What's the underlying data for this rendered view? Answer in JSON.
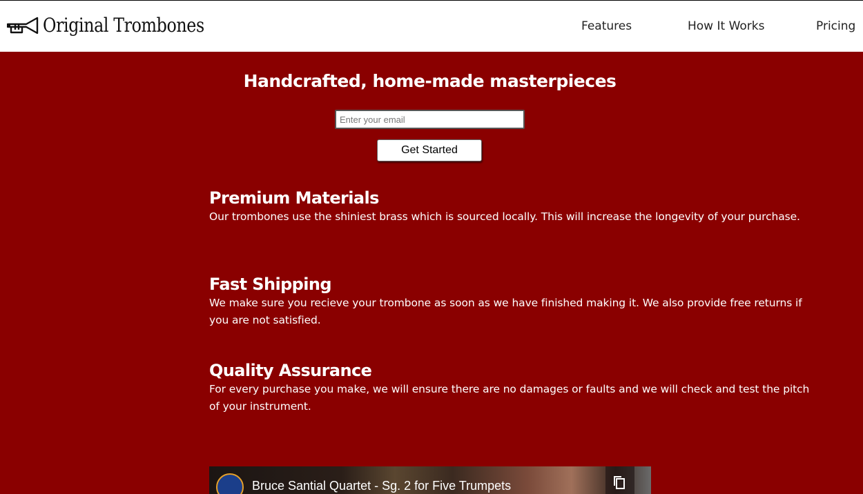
{
  "header": {
    "logo_text": "Original Trombones",
    "logo_icon": "trombone-icon",
    "nav": [
      {
        "label": "Features"
      },
      {
        "label": "How It Works"
      },
      {
        "label": "Pricing"
      }
    ]
  },
  "hero": {
    "title": "Handcrafted, home-made masterpieces",
    "email_placeholder": "Enter your email",
    "email_value": "",
    "submit_label": "Get Started"
  },
  "features": [
    {
      "title": "Premium Materials",
      "description": "Our trombones use the shiniest brass which is sourced locally. This will increase the longevity of your purchase."
    },
    {
      "title": "Fast Shipping",
      "description": "We make sure you recieve your trombone as soon as we have finished making it. We also provide free returns if you are not satisfied."
    },
    {
      "title": "Quality Assurance",
      "description": "For every purchase you make, we will ensure there are no damages or faults and we will check and test the pitch of your instrument."
    }
  ],
  "video": {
    "title": "Bruce Santial Quartet - Sg. 2 for Five Trumpets",
    "copy_icon": "copy-icon"
  },
  "colors": {
    "background": "#8a0000",
    "header_background": "#ffffff",
    "text_light": "#ffffff"
  }
}
